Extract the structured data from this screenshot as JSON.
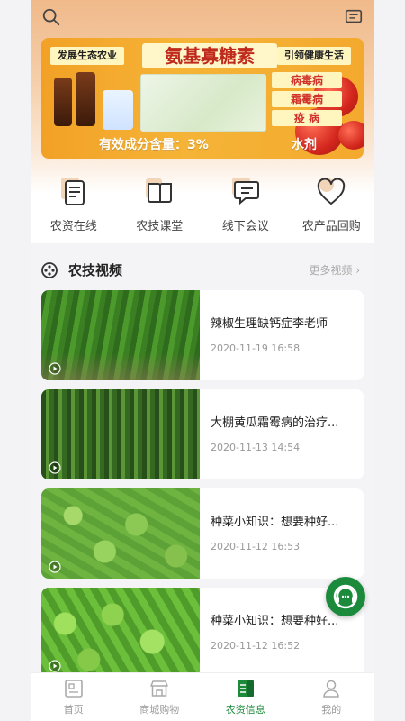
{
  "banner": {
    "left_tag": "发展生态农业",
    "title": "氨基寡糖素",
    "right_tag": "引领健康生活",
    "diseases": [
      "病毒病",
      "霜霉病",
      "疫 病"
    ],
    "content_text": "有效成分含量：3%",
    "dosage_text": "水剂"
  },
  "categories": [
    {
      "label": "农资在线",
      "icon": "document-icon"
    },
    {
      "label": "农技课堂",
      "icon": "book-icon"
    },
    {
      "label": "线下会议",
      "icon": "chat-icon"
    },
    {
      "label": "农产品回购",
      "icon": "heart-icon"
    }
  ],
  "section": {
    "title": "农技视频",
    "more": "更多视频 ›"
  },
  "videos": [
    {
      "title": "辣椒生理缺钙症李老师",
      "time": "2020-11-19 16:58",
      "thumb": "pepper"
    },
    {
      "title": "大棚黄瓜霜霉病的治疗...",
      "time": "2020-11-13 14:54",
      "thumb": "cucumber"
    },
    {
      "title": "种菜小知识：想要种好...",
      "time": "2020-11-12 16:53",
      "thumb": "lettuce"
    },
    {
      "title": "种菜小知识：想要种好...",
      "time": "2020-11-12 16:52",
      "thumb": "lettuce"
    }
  ],
  "tabs": [
    {
      "label": "首页",
      "active": false
    },
    {
      "label": "商城购物",
      "active": false
    },
    {
      "label": "农资信息",
      "active": true
    },
    {
      "label": "我的",
      "active": false
    }
  ],
  "colors": {
    "accent": "#1b8a3a",
    "header_top": "#f0b98a"
  }
}
